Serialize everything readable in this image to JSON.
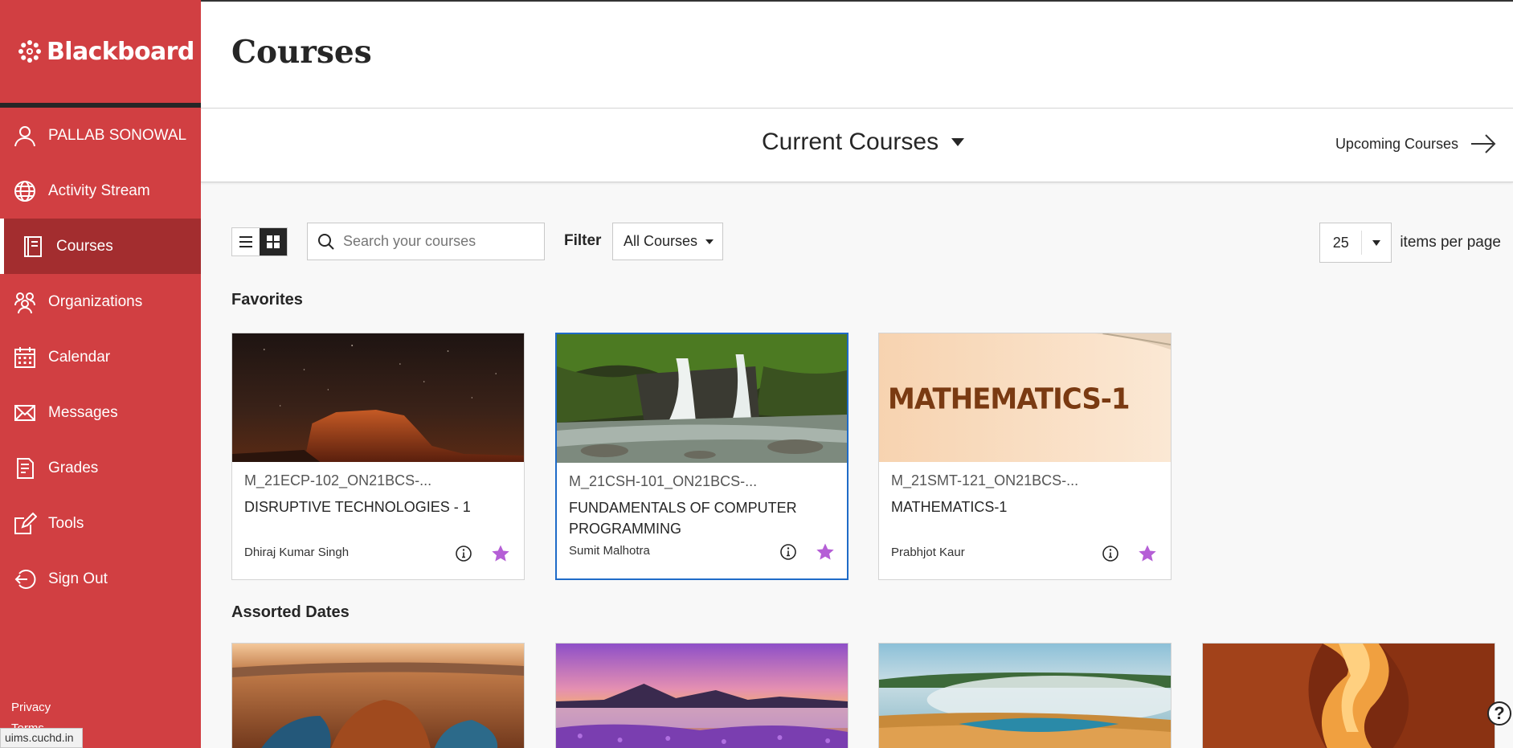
{
  "brand": {
    "name": "Blackboard",
    "icon": "blackboard-logo-icon"
  },
  "sidebar": {
    "items": [
      {
        "label": "PALLAB SONOWAL",
        "icon": "user-icon"
      },
      {
        "label": "Activity Stream",
        "icon": "globe-icon"
      },
      {
        "label": "Courses",
        "icon": "courses-icon",
        "active": true
      },
      {
        "label": "Organizations",
        "icon": "organizations-icon"
      },
      {
        "label": "Calendar",
        "icon": "calendar-icon"
      },
      {
        "label": "Messages",
        "icon": "envelope-icon"
      },
      {
        "label": "Grades",
        "icon": "grades-icon"
      },
      {
        "label": "Tools",
        "icon": "tools-icon"
      },
      {
        "label": "Sign Out",
        "icon": "sign-out-icon"
      }
    ],
    "footer": {
      "privacy": "Privacy",
      "terms": "Terms"
    }
  },
  "status_url": "uims.cuchd.in",
  "header": {
    "title": "Courses"
  },
  "term_bar": {
    "current": "Current Courses",
    "upcoming": "Upcoming Courses"
  },
  "toolbar": {
    "search_placeholder": "Search your courses",
    "filter_label": "Filter",
    "filter_value": "All Courses",
    "per_page_value": "25",
    "per_page_label": "items per page"
  },
  "sections": {
    "favorites": {
      "title": "Favorites",
      "courses": [
        {
          "id": "M_21ECP-102_ON21BCS-...",
          "name": "DISRUPTIVE TECHNOLOGIES - 1",
          "instructor": "Dhiraj Kumar Singh",
          "favorite": true,
          "image": "night-mesa"
        },
        {
          "id": "M_21CSH-101_ON21BCS-...",
          "name": "FUNDAMENTALS OF COMPUTER PROGRAMMING",
          "instructor": "Sumit Malhotra",
          "favorite": true,
          "image": "waterfall",
          "selected": true
        },
        {
          "id": "M_21SMT-121_ON21BCS-...",
          "name": "MATHEMATICS-1",
          "instructor": "Prabhjot Kaur",
          "favorite": true,
          "image": "mathematics-banner",
          "banner_text": "MATHEMATICS-1"
        }
      ]
    },
    "assorted": {
      "title": "Assorted Dates",
      "courses": [
        {
          "image": "canyon-river"
        },
        {
          "image": "purple-lake"
        },
        {
          "image": "hot-spring"
        },
        {
          "image": "slot-canyon"
        }
      ]
    }
  },
  "colors": {
    "sidebar": "#d13f42",
    "active_nav": "#a32d2f",
    "star": "#b55fd6",
    "selected_border": "#1f6bc8"
  }
}
